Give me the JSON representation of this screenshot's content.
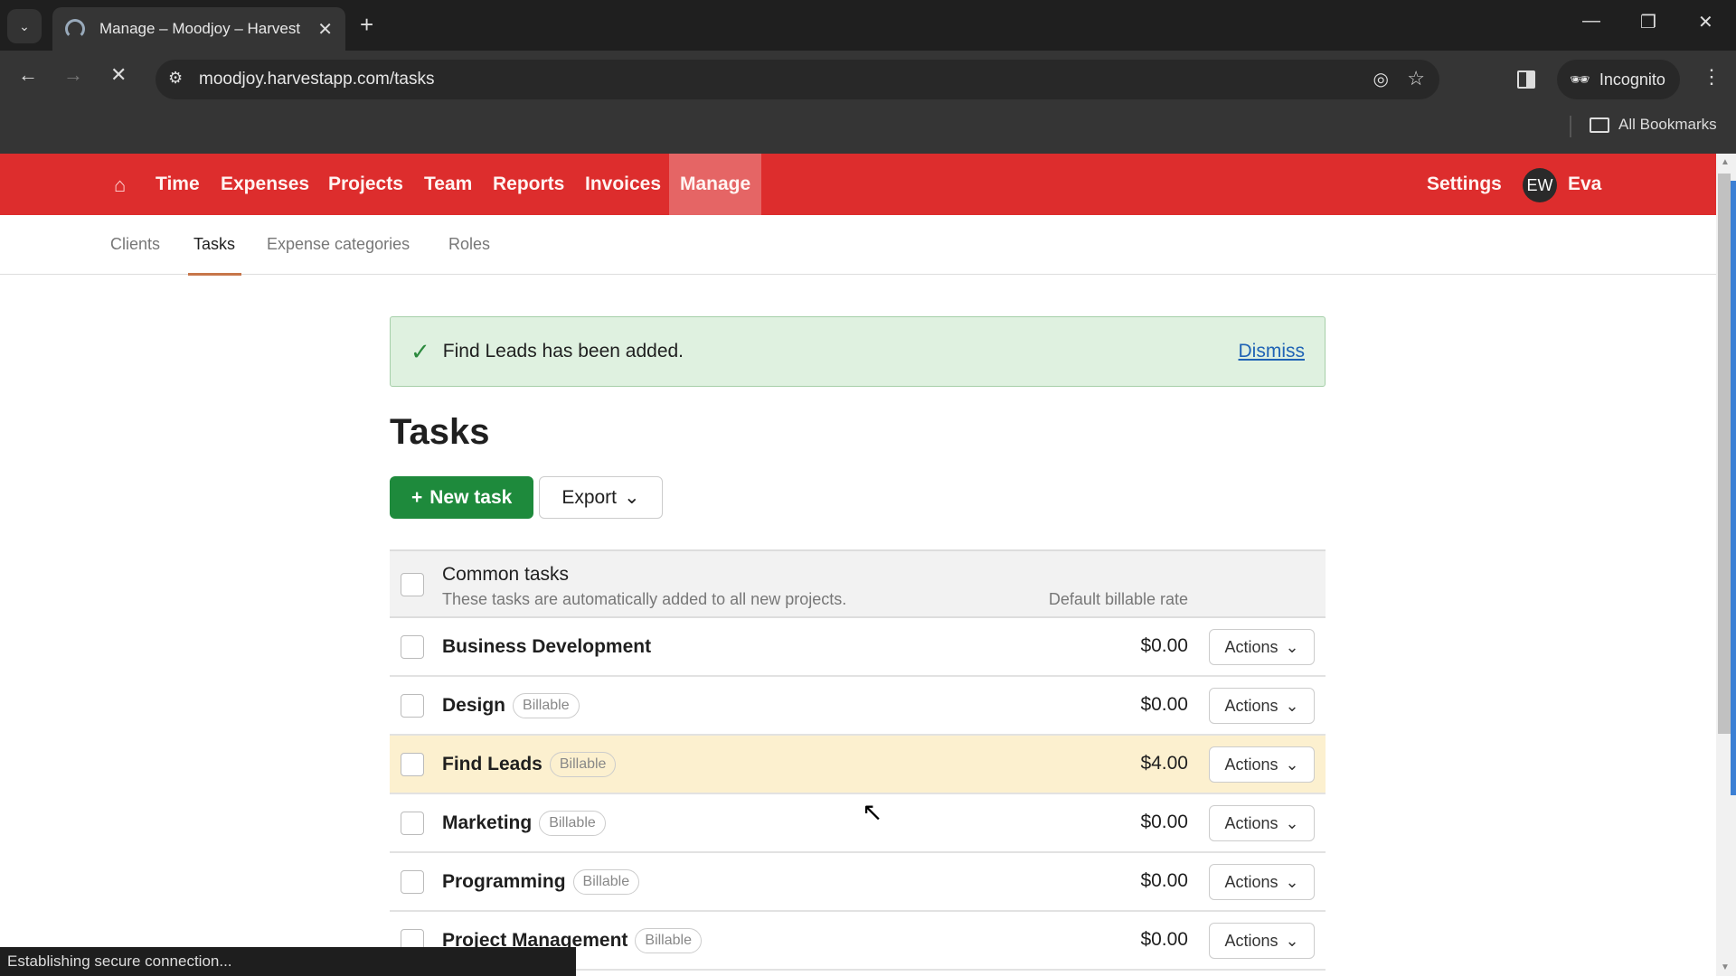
{
  "browser": {
    "tab_title": "Manage – Moodjoy – Harvest",
    "url": "moodjoy.harvestapp.com/tasks",
    "incognito_label": "Incognito",
    "bookmarks_label": "All Bookmarks",
    "status_text": "Establishing secure connection..."
  },
  "mainnav": {
    "items": [
      {
        "label": "Time"
      },
      {
        "label": "Expenses"
      },
      {
        "label": "Projects"
      },
      {
        "label": "Team"
      },
      {
        "label": "Reports"
      },
      {
        "label": "Invoices"
      },
      {
        "label": "Manage",
        "active": true
      }
    ],
    "settings_label": "Settings",
    "user_initials": "EW",
    "user_name": "Eva",
    "brand_color": "#dd2d2d"
  },
  "subnav": {
    "items": [
      {
        "label": "Clients"
      },
      {
        "label": "Tasks",
        "active": true
      },
      {
        "label": "Expense categories"
      },
      {
        "label": "Roles"
      }
    ]
  },
  "alert": {
    "message": "Find Leads has been added.",
    "dismiss_label": "Dismiss"
  },
  "page_title": "Tasks",
  "buttons": {
    "new_task": "New task",
    "export": "Export"
  },
  "table": {
    "group_title": "Common tasks",
    "group_description": "These tasks are automatically added to all new projects.",
    "rate_header": "Default billable rate",
    "actions_label": "Actions",
    "rows": [
      {
        "name": "Business Development",
        "billable": false,
        "badge": "",
        "rate": "$0.00",
        "highlight": false
      },
      {
        "name": "Design",
        "billable": true,
        "badge": "Billable",
        "rate": "$0.00",
        "highlight": false
      },
      {
        "name": "Find Leads",
        "billable": true,
        "badge": "Billable",
        "rate": "$4.00",
        "highlight": true
      },
      {
        "name": "Marketing",
        "billable": true,
        "badge": "Billable",
        "rate": "$0.00",
        "highlight": false
      },
      {
        "name": "Programming",
        "billable": true,
        "badge": "Billable",
        "rate": "$0.00",
        "highlight": false
      },
      {
        "name": "Project Management",
        "billable": true,
        "badge": "Billable",
        "rate": "$0.00",
        "highlight": false
      }
    ]
  }
}
